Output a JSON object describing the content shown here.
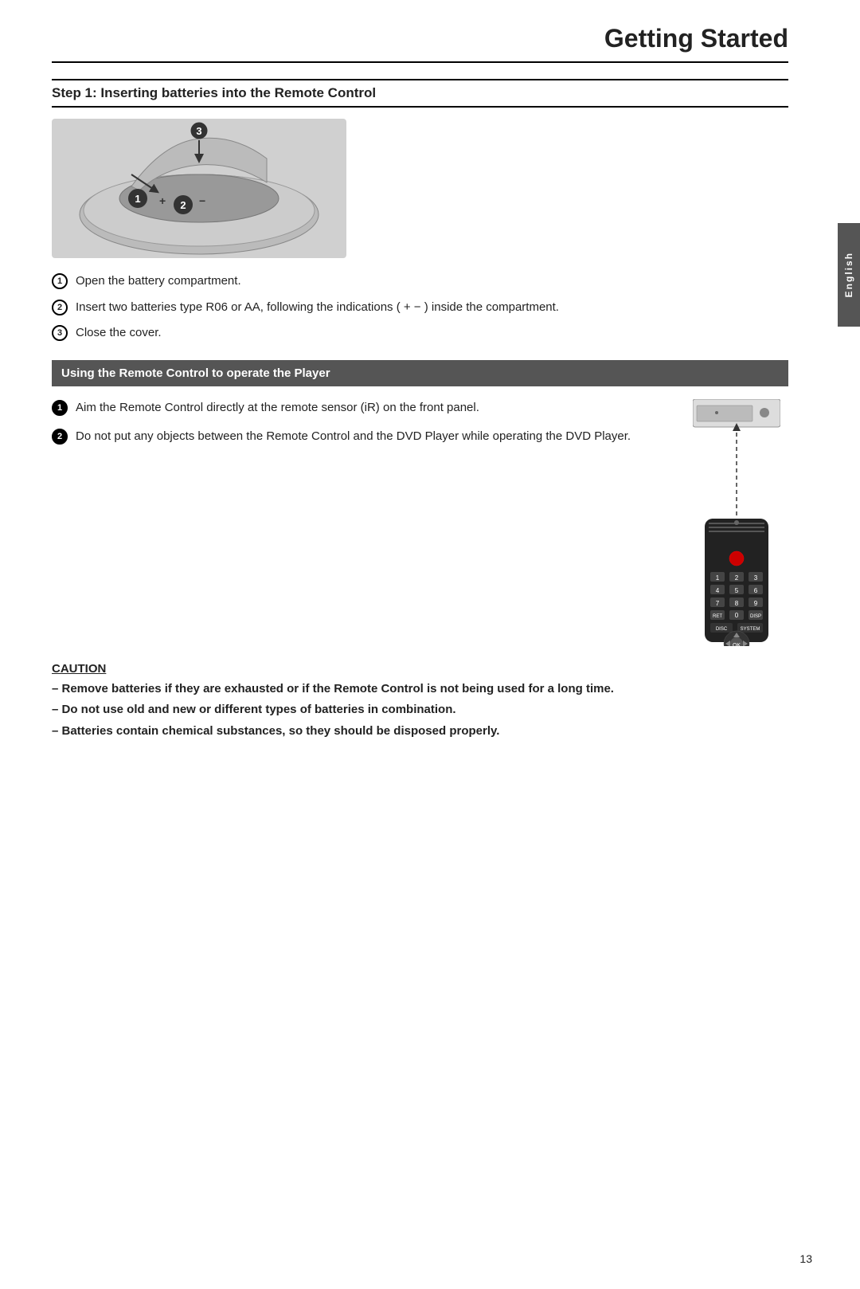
{
  "page": {
    "title": "Getting Started",
    "page_number": "13",
    "english_tab": "English"
  },
  "step1": {
    "header": "Step 1:    Inserting batteries into the Remote Control",
    "instructions": [
      {
        "num": "1",
        "text": "Open the battery compartment.",
        "filled": false
      },
      {
        "num": "2",
        "text": "Insert two batteries type R06 or AA, following the indications ( + − ) inside the compartment.",
        "filled": false
      },
      {
        "num": "3",
        "text": "Close the cover.",
        "filled": false
      }
    ]
  },
  "using_section": {
    "header": "Using the Remote Control to operate the Player",
    "instructions": [
      {
        "num": "1",
        "text": "Aim the Remote Control directly at the remote sensor (iR) on the front panel.",
        "filled": true
      },
      {
        "num": "2",
        "text": "Do not put any objects between the Remote Control and the DVD Player while operating the DVD Player.",
        "filled": true
      }
    ]
  },
  "caution": {
    "title": "CAUTION",
    "items": [
      "–  Remove batteries if they are exhausted or if the Remote Control is not being used for a long time.",
      "–  Do not use old and new or different types of batteries in combination.",
      "–  Batteries contain chemical substances, so they should be disposed properly."
    ]
  }
}
